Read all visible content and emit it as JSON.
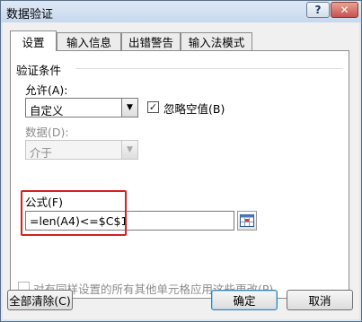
{
  "window": {
    "title": "数据验证",
    "help_label": "?",
    "close_label": "✕"
  },
  "tabs": [
    {
      "label": "设置",
      "active": true
    },
    {
      "label": "输入信息",
      "active": false
    },
    {
      "label": "出错警告",
      "active": false
    },
    {
      "label": "输入法模式",
      "active": false
    }
  ],
  "settings": {
    "group_title": "验证条件",
    "allow": {
      "label": "允许(A):",
      "value": "自定义"
    },
    "ignore_blank": {
      "label": "忽略空值(B)",
      "checked": true
    },
    "data": {
      "label": "数据(D):",
      "value": "介于",
      "disabled": true
    },
    "formula": {
      "label": "公式(F)",
      "value": "=len(A4)<=$C$1"
    },
    "apply_all": {
      "label": "对有同样设置的所有其他单元格应用这些更改(P)",
      "checked": false,
      "disabled": true
    }
  },
  "buttons": {
    "clear_all": "全部清除(C)",
    "ok": "确定",
    "cancel": "取消"
  },
  "colors": {
    "highlight": "#d42020",
    "title_bar": "#c7d8ee",
    "close_button": "#c75050"
  }
}
